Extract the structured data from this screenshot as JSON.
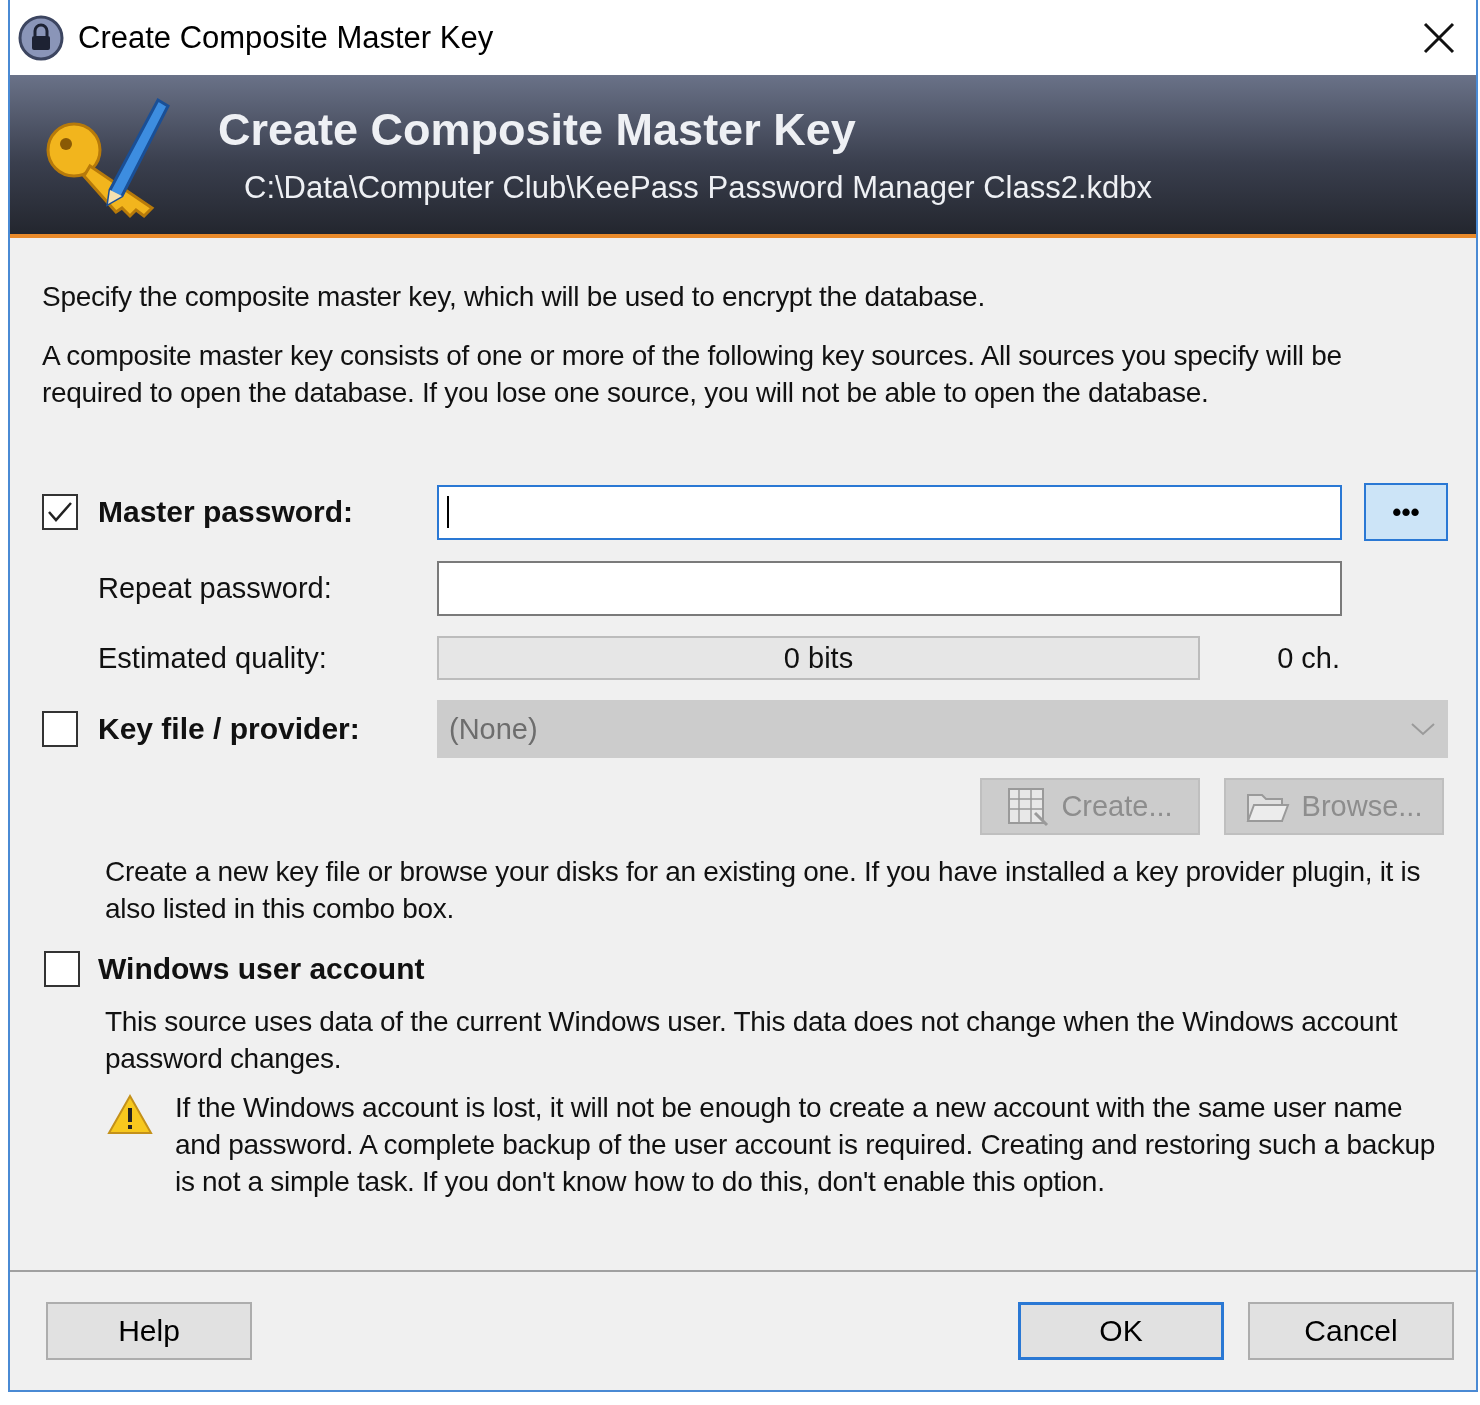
{
  "window": {
    "title": "Create Composite Master Key"
  },
  "header": {
    "title": "Create Composite Master Key",
    "path": "C:\\Data\\Computer Club\\KeePass Password Manager Class2.kdbx"
  },
  "intro": [
    "Specify the composite master key, which will be used to encrypt the database.",
    "A composite master key consists of one or more of the following key sources. All sources you specify will be required to open the database.  If you lose one source, you will not be able to open the database."
  ],
  "master_password": {
    "checked": true,
    "label": "Master password:",
    "focused": true,
    "show_button": "•••",
    "show_pressed": true
  },
  "repeat_password": {
    "label": "Repeat password:",
    "focused": false
  },
  "quality": {
    "label": "Estimated quality:",
    "level": 0,
    "reading": "0 bits",
    "length": "0 ch."
  },
  "key_file": {
    "checked": false,
    "label": "Key file / provider:",
    "value": "(None)",
    "disabled": true,
    "buttons": [
      {
        "label": "Create...",
        "kind": "create",
        "disabled": true
      },
      {
        "label": "Browse...",
        "kind": "browse",
        "disabled": true
      }
    ],
    "description": "Create a new key file or browse your disks for an existing one. If you have installed a key provider plugin, it is also listed in this combo box."
  },
  "windows_account": {
    "checked": false,
    "label": "Windows user account",
    "description": "This source uses data of the current Windows user. This data does not change when the Windows account password changes.",
    "warning": "If the Windows account is lost, it will not be enough to create a new account with the same user name and password. A complete backup of the user account is required. Creating and restoring such a backup is not a simple task. If you don't know how to do this, don't enable this option."
  },
  "buttons": [
    {
      "label": "Help",
      "default": false
    },
    {
      "label": "OK",
      "default": true
    },
    {
      "label": "Cancel",
      "default": false
    }
  ]
}
